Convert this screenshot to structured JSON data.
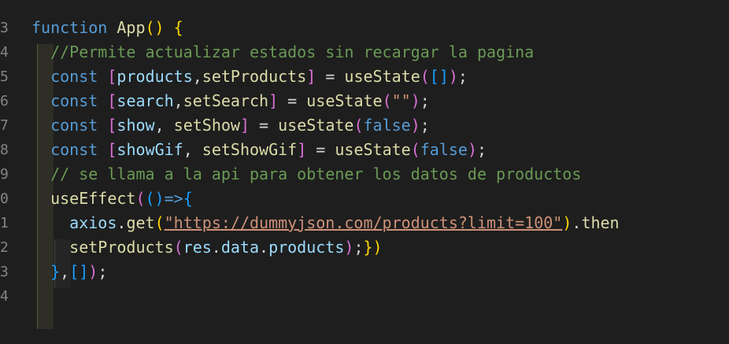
{
  "editor": {
    "line_numbers": [
      "3",
      "4",
      "5",
      "6",
      "7",
      "8",
      "9",
      "0",
      "1",
      "2",
      "3",
      "4"
    ],
    "lines": [
      [
        {
          "t": "function",
          "c": "kw"
        },
        {
          "t": " ",
          "c": "op"
        },
        {
          "t": "App",
          "c": "fn"
        },
        {
          "t": "()",
          "c": "p1"
        },
        {
          "t": " ",
          "c": "op"
        },
        {
          "t": "{",
          "c": "p1"
        }
      ],
      [
        {
          "t": "  ",
          "c": "op"
        },
        {
          "t": "//Permite actualizar estados sin recargar la pagina",
          "c": "cm"
        }
      ],
      [
        {
          "t": "  ",
          "c": "op"
        },
        {
          "t": "const",
          "c": "kw"
        },
        {
          "t": " ",
          "c": "op"
        },
        {
          "t": "[",
          "c": "p2"
        },
        {
          "t": "products",
          "c": "var"
        },
        {
          "t": ",",
          "c": "op"
        },
        {
          "t": "setProducts",
          "c": "fn"
        },
        {
          "t": "]",
          "c": "p2"
        },
        {
          "t": " = ",
          "c": "op"
        },
        {
          "t": "useState",
          "c": "fn"
        },
        {
          "t": "(",
          "c": "p2"
        },
        {
          "t": "[]",
          "c": "p3"
        },
        {
          "t": ")",
          "c": "p2"
        },
        {
          "t": ";",
          "c": "op"
        }
      ],
      [
        {
          "t": "  ",
          "c": "op"
        },
        {
          "t": "const",
          "c": "kw"
        },
        {
          "t": " ",
          "c": "op"
        },
        {
          "t": "[",
          "c": "p2"
        },
        {
          "t": "search",
          "c": "var"
        },
        {
          "t": ",",
          "c": "op"
        },
        {
          "t": "setSearch",
          "c": "fn"
        },
        {
          "t": "]",
          "c": "p2"
        },
        {
          "t": " = ",
          "c": "op"
        },
        {
          "t": "useState",
          "c": "fn"
        },
        {
          "t": "(",
          "c": "p2"
        },
        {
          "t": "\"\"",
          "c": "str"
        },
        {
          "t": ")",
          "c": "p2"
        },
        {
          "t": ";",
          "c": "op"
        }
      ],
      [
        {
          "t": "  ",
          "c": "op"
        },
        {
          "t": "const",
          "c": "kw"
        },
        {
          "t": " ",
          "c": "op"
        },
        {
          "t": "[",
          "c": "p2"
        },
        {
          "t": "show",
          "c": "var"
        },
        {
          "t": ", ",
          "c": "op"
        },
        {
          "t": "setShow",
          "c": "fn"
        },
        {
          "t": "]",
          "c": "p2"
        },
        {
          "t": " = ",
          "c": "op"
        },
        {
          "t": "useState",
          "c": "fn"
        },
        {
          "t": "(",
          "c": "p2"
        },
        {
          "t": "false",
          "c": "bool"
        },
        {
          "t": ")",
          "c": "p2"
        },
        {
          "t": ";",
          "c": "op"
        }
      ],
      [
        {
          "t": "  ",
          "c": "op"
        },
        {
          "t": "const",
          "c": "kw"
        },
        {
          "t": " ",
          "c": "op"
        },
        {
          "t": "[",
          "c": "p2"
        },
        {
          "t": "showGif",
          "c": "var"
        },
        {
          "t": ", ",
          "c": "op"
        },
        {
          "t": "setShowGif",
          "c": "fn"
        },
        {
          "t": "]",
          "c": "p2"
        },
        {
          "t": " = ",
          "c": "op"
        },
        {
          "t": "useState",
          "c": "fn"
        },
        {
          "t": "(",
          "c": "p2"
        },
        {
          "t": "false",
          "c": "bool"
        },
        {
          "t": ")",
          "c": "p2"
        },
        {
          "t": ";",
          "c": "op"
        }
      ],
      [
        {
          "t": "  ",
          "c": "op"
        },
        {
          "t": "// se llama a la api para obtener los datos de productos",
          "c": "cm"
        }
      ],
      [
        {
          "t": "  ",
          "c": "op"
        },
        {
          "t": "useEffect",
          "c": "fn"
        },
        {
          "t": "(",
          "c": "p2"
        },
        {
          "t": "()",
          "c": "p3"
        },
        {
          "t": "=>",
          "c": "kw"
        },
        {
          "t": "{",
          "c": "p3"
        }
      ],
      [
        {
          "t": "    ",
          "c": "op"
        },
        {
          "t": "axios",
          "c": "var"
        },
        {
          "t": ".",
          "c": "op"
        },
        {
          "t": "get",
          "c": "fn"
        },
        {
          "t": "(",
          "c": "p1"
        },
        {
          "t": "\"https://dummyjson.com/products?limit=100\"",
          "c": "str url"
        },
        {
          "t": ")",
          "c": "p1"
        },
        {
          "t": ".",
          "c": "op"
        },
        {
          "t": "then",
          "c": "fn"
        }
      ],
      [
        {
          "t": "    ",
          "c": "op"
        },
        {
          "t": "setProducts",
          "c": "fn"
        },
        {
          "t": "(",
          "c": "p2"
        },
        {
          "t": "res",
          "c": "var"
        },
        {
          "t": ".",
          "c": "op"
        },
        {
          "t": "data",
          "c": "var"
        },
        {
          "t": ".",
          "c": "op"
        },
        {
          "t": "products",
          "c": "var"
        },
        {
          "t": ")",
          "c": "p2"
        },
        {
          "t": ";",
          "c": "op"
        },
        {
          "t": "}",
          "c": "p1"
        },
        {
          "t": ")",
          "c": "p1"
        }
      ],
      [
        {
          "t": "  ",
          "c": "op"
        },
        {
          "t": "}",
          "c": "p3"
        },
        {
          "t": ",",
          "c": "op"
        },
        {
          "t": "[]",
          "c": "p3"
        },
        {
          "t": ")",
          "c": "p2"
        },
        {
          "t": ";",
          "c": "op"
        }
      ],
      []
    ]
  }
}
